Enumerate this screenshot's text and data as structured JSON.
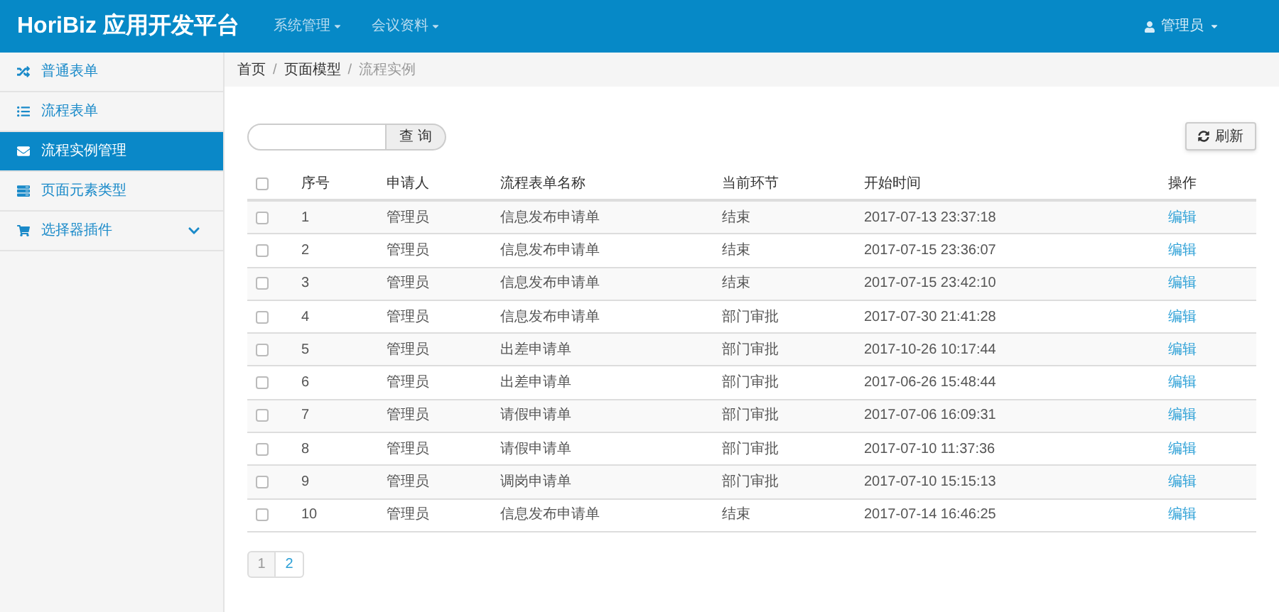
{
  "header": {
    "brand": "HoriBiz 应用开发平台",
    "menus": [
      "系统管理",
      "会议资料"
    ],
    "user": "管理员"
  },
  "sidebar": {
    "items": [
      {
        "label": "普通表单",
        "selected": false
      },
      {
        "label": "流程表单",
        "selected": false
      },
      {
        "label": "流程实例管理",
        "selected": true
      },
      {
        "label": "页面元素类型",
        "selected": false
      },
      {
        "label": "选择器插件",
        "selected": false
      }
    ]
  },
  "breadcrumb": {
    "separator": "/",
    "items": [
      "首页",
      "页面模型",
      "流程实例"
    ]
  },
  "search": {
    "button": "查 询"
  },
  "refresh_button": "刷新",
  "table": {
    "select_all": {
      "checked": false
    },
    "columns": [
      "序号",
      "申请人",
      "流程表单名称",
      "当前环节",
      "开始时间",
      "操作"
    ],
    "rows": [
      {
        "checked": false,
        "cells": [
          "1",
          "管理员",
          "信息发布申请单",
          "结束",
          "2017-07-13 23:37:18"
        ],
        "action": "编辑"
      },
      {
        "checked": false,
        "cells": [
          "2",
          "管理员",
          "信息发布申请单",
          "结束",
          "2017-07-15 23:36:07"
        ],
        "action": "编辑"
      },
      {
        "checked": false,
        "cells": [
          "3",
          "管理员",
          "信息发布申请单",
          "结束",
          "2017-07-15 23:42:10"
        ],
        "action": "编辑"
      },
      {
        "checked": false,
        "cells": [
          "4",
          "管理员",
          "信息发布申请单",
          "部门审批",
          "2017-07-30 21:41:28"
        ],
        "action": "编辑"
      },
      {
        "checked": false,
        "cells": [
          "5",
          "管理员",
          "出差申请单",
          "部门审批",
          "2017-10-26 10:17:44"
        ],
        "action": "编辑"
      },
      {
        "checked": false,
        "cells": [
          "6",
          "管理员",
          "出差申请单",
          "部门审批",
          "2017-06-26 15:48:44"
        ],
        "action": "编辑"
      },
      {
        "checked": false,
        "cells": [
          "7",
          "管理员",
          "请假申请单",
          "部门审批",
          "2017-07-06 16:09:31"
        ],
        "action": "编辑"
      },
      {
        "checked": false,
        "cells": [
          "8",
          "管理员",
          "请假申请单",
          "部门审批",
          "2017-07-10 11:37:36"
        ],
        "action": "编辑"
      },
      {
        "checked": false,
        "cells": [
          "9",
          "管理员",
          "调岗申请单",
          "部门审批",
          "2017-07-10 15:15:13"
        ],
        "action": "编辑"
      },
      {
        "checked": false,
        "cells": [
          "10",
          "管理员",
          "信息发布申请单",
          "结束",
          "2017-07-14 16:46:25"
        ],
        "action": "编辑"
      }
    ]
  },
  "pagination": [
    {
      "label": "1",
      "selected": true
    },
    {
      "label": "2",
      "selected": false
    }
  ]
}
